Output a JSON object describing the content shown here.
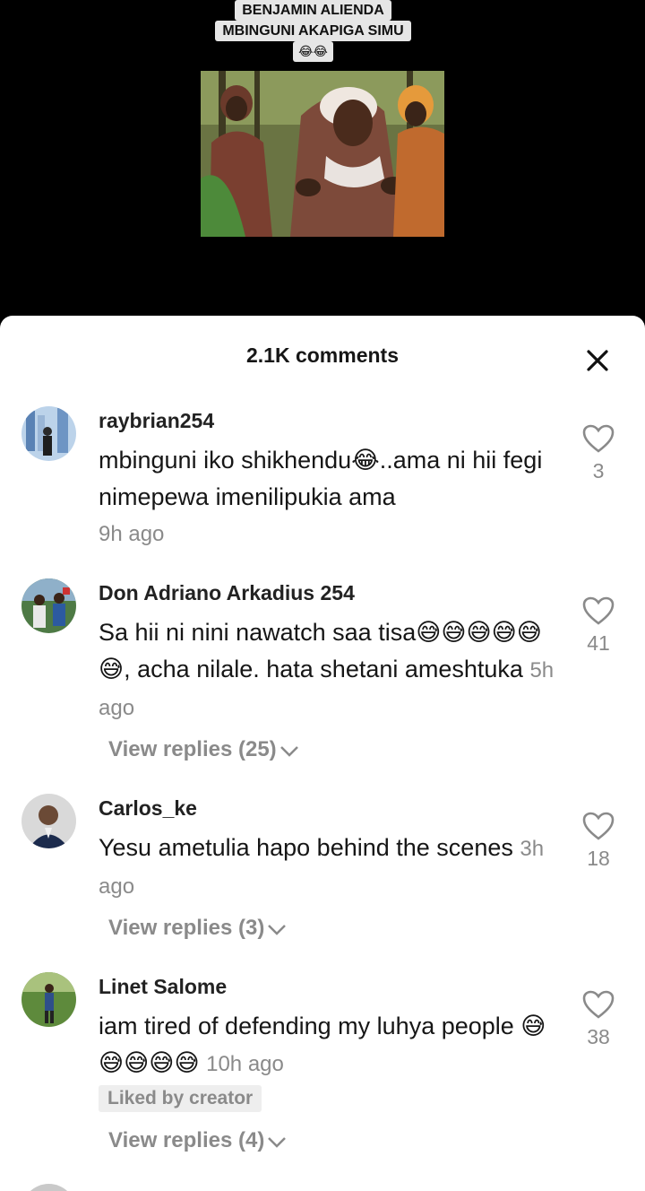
{
  "video": {
    "caption_line1": "BENJAMIN ALIENDA",
    "caption_line2": "MBINGUNI AKAPIGA SIMU",
    "caption_emoji": "😂😂"
  },
  "sheet": {
    "title": "2.1K comments",
    "close_icon": "close-icon"
  },
  "comments": [
    {
      "username": "raybrian254",
      "text": "mbinguni iko shikhendu😂..ama ni hii fegi nimepewa imenilipukia ama",
      "time": "9h ago",
      "likes": "3"
    },
    {
      "username": "Don Adriano Arkadius 254",
      "text": "Sa hii ni nini nawatch saa tisa😅😅😅😅😅😅, acha nilale. hata shetani ameshtuka",
      "time": "5h ago",
      "likes": "41",
      "replies": "View replies (25)"
    },
    {
      "username": "Carlos_ke",
      "text": "Yesu ametulia hapo behind the scenes",
      "time": "3h ago",
      "likes": "18",
      "replies": "View replies (3)"
    },
    {
      "username": "Linet Salome",
      "text": "iam tired of defending my luhya people 😅😅😅😅😅",
      "time": "10h ago",
      "likes": "38",
      "badge": "Liked by creator",
      "replies": "View replies (4)"
    }
  ],
  "colors": {
    "text": "#161616",
    "muted": "#8a8a8a",
    "sheet_bg": "#ffffff",
    "video_bg": "#000000"
  }
}
